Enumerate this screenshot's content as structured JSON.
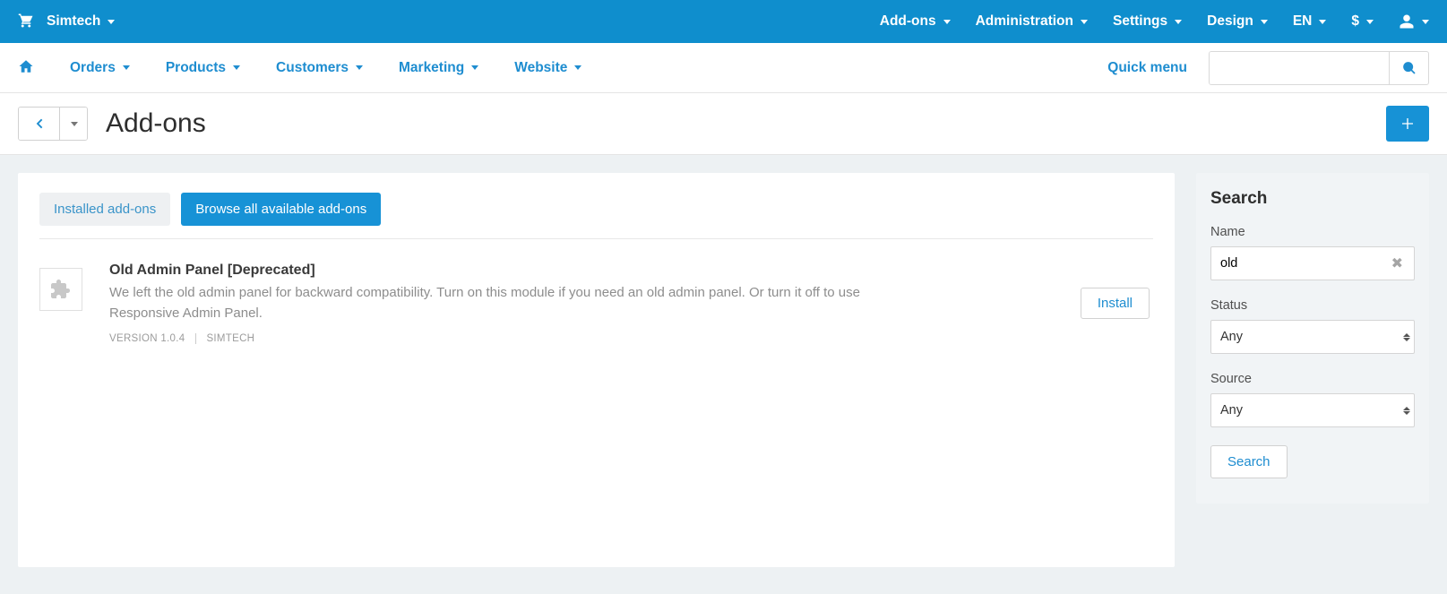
{
  "topbar": {
    "brand": "Simtech",
    "right": {
      "addons": "Add-ons",
      "administration": "Administration",
      "settings": "Settings",
      "design": "Design",
      "lang": "EN",
      "currency": "$"
    }
  },
  "navbar": {
    "orders": "Orders",
    "products": "Products",
    "customers": "Customers",
    "marketing": "Marketing",
    "website": "Website",
    "quick_menu": "Quick menu"
  },
  "page": {
    "title": "Add-ons"
  },
  "tabs": {
    "installed": "Installed add-ons",
    "browse": "Browse all available add-ons"
  },
  "addon": {
    "title": "Old Admin Panel [Deprecated]",
    "desc": "We left the old admin panel for backward compatibility. Turn on this module if you need an old admin panel. Or turn it off to use Responsive Admin Panel.",
    "version_label": "VERSION 1.0.4",
    "vendor": "SIMTECH",
    "install": "Install"
  },
  "side": {
    "title": "Search",
    "name_label": "Name",
    "name_value": "old",
    "status_label": "Status",
    "status_value": "Any",
    "source_label": "Source",
    "source_value": "Any",
    "search_btn": "Search"
  }
}
